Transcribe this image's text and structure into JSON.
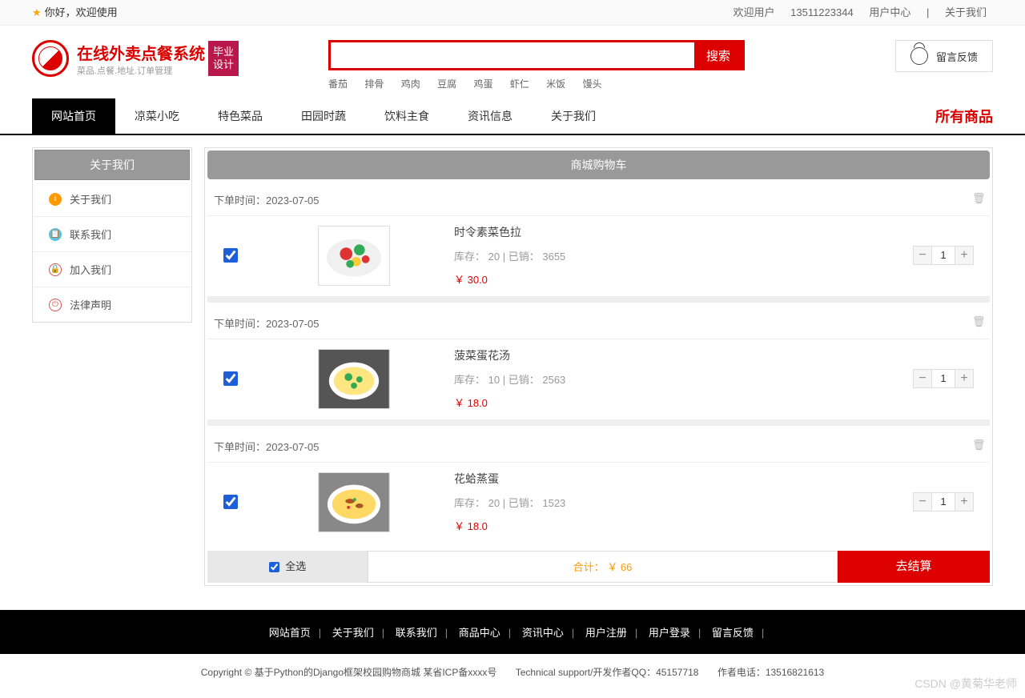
{
  "topbar": {
    "welcome": "你好，欢迎使用",
    "user_label": "欢迎用户",
    "phone": "13511223344",
    "user_center": "用户中心",
    "about": "关于我们"
  },
  "logo": {
    "title": "在线外卖点餐系统",
    "subtitle": "菜品.点餐.地址.订单管理",
    "badge1": "毕业",
    "badge2": "设计"
  },
  "search": {
    "button": "搜索",
    "hotwords": [
      "番茄",
      "排骨",
      "鸡肉",
      "豆腐",
      "鸡蛋",
      "虾仁",
      "米饭",
      "馒头"
    ]
  },
  "feedback": "留言反馈",
  "nav": {
    "items": [
      "网站首页",
      "凉菜小吃",
      "特色菜品",
      "田园时蔬",
      "饮料主食",
      "资讯信息",
      "关于我们"
    ],
    "allgoods": "所有商品"
  },
  "sidebar": {
    "header": "关于我们",
    "items": [
      "关于我们",
      "联系我们",
      "加入我们",
      "法律声明"
    ]
  },
  "cart": {
    "header": "商城购物车",
    "order_time_label": "下单时间：",
    "stock_label": "库存：",
    "sold_label": "已销：",
    "items": [
      {
        "time": "2023-07-05",
        "name": "时令素菜色拉",
        "stock": "20",
        "sold": "3655",
        "price": "￥ 30.0",
        "qty": "1"
      },
      {
        "time": "2023-07-05",
        "name": "菠菜蛋花汤",
        "stock": "10",
        "sold": "2563",
        "price": "￥ 18.0",
        "qty": "1"
      },
      {
        "time": "2023-07-05",
        "name": "花蛤蒸蛋",
        "stock": "20",
        "sold": "1523",
        "price": "￥ 18.0",
        "qty": "1"
      }
    ],
    "select_all": "全选",
    "total_label": "合计：",
    "total": "￥ 66",
    "checkout": "去结算"
  },
  "footer": {
    "links": [
      "网站首页",
      "关于我们",
      "联系我们",
      "商品中心",
      "资讯中心",
      "用户注册",
      "用户登录",
      "留言反馈"
    ]
  },
  "copyright": {
    "text": "Copyright © 基于Python的Django框架校园购物商城 某省ICP备xxxx号",
    "support": "Technical support/开发作者QQ：45157718",
    "tel": "作者电话：13516821613"
  },
  "watermark": "CSDN @黄菊华老师"
}
